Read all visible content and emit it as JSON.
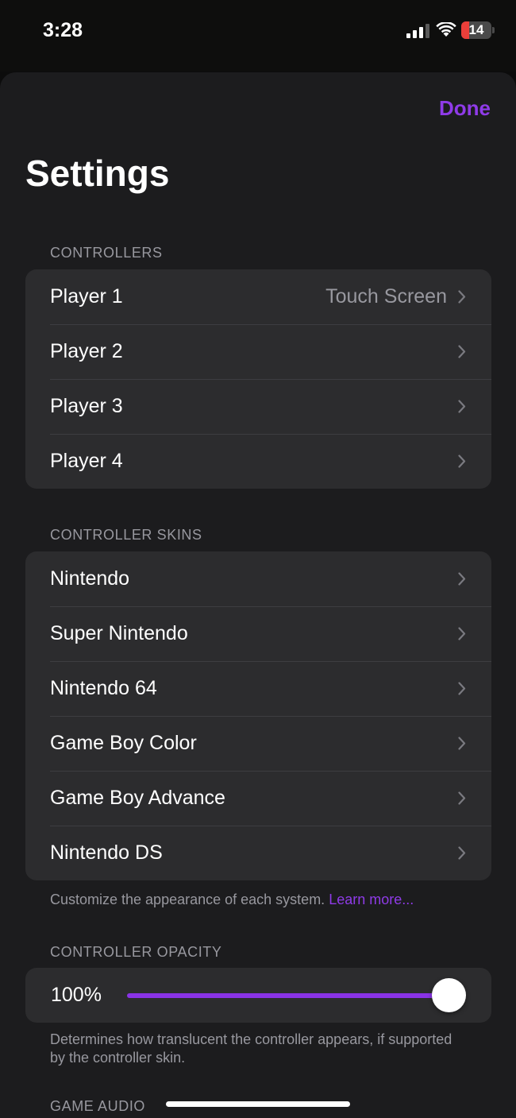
{
  "status_bar": {
    "time": "3:28",
    "battery_level": "14"
  },
  "header": {
    "done_label": "Done",
    "title": "Settings"
  },
  "controllers": {
    "header": "CONTROLLERS",
    "rows": [
      {
        "label": "Player 1",
        "value": "Touch Screen"
      },
      {
        "label": "Player 2",
        "value": ""
      },
      {
        "label": "Player 3",
        "value": ""
      },
      {
        "label": "Player 4",
        "value": ""
      }
    ]
  },
  "controller_skins": {
    "header": "CONTROLLER SKINS",
    "rows": [
      {
        "label": "Nintendo"
      },
      {
        "label": "Super Nintendo"
      },
      {
        "label": "Nintendo 64"
      },
      {
        "label": "Game Boy Color"
      },
      {
        "label": "Game Boy Advance"
      },
      {
        "label": "Nintendo DS"
      }
    ],
    "footer": "Customize the appearance of each system.",
    "footer_link": "Learn more..."
  },
  "controller_opacity": {
    "header": "CONTROLLER OPACITY",
    "value_label": "100%",
    "level": 1.0,
    "footer": "Determines how translucent the controller appears, if supported by the controller skin."
  },
  "game_audio": {
    "header": "GAME AUDIO"
  },
  "colors": {
    "accent": "#8f3be8",
    "background": "#1c1c1e",
    "cell": "#2c2c2e",
    "secondary_text": "#98989f"
  }
}
